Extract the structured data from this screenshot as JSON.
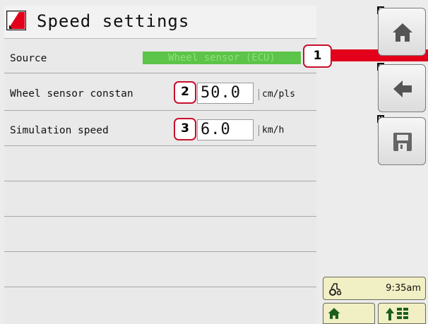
{
  "header": {
    "title": "Speed settings",
    "logo_icon": "red-slash-logo"
  },
  "rows": [
    {
      "label": "Source",
      "value": "Wheel sensor (ECU)"
    },
    {
      "label": "Wheel sensor constan",
      "value": "50.0",
      "unit": "cm/pls"
    },
    {
      "label": "Simulation speed",
      "value": "6.0",
      "unit": "km/h"
    }
  ],
  "callouts": [
    "1",
    "2",
    "3"
  ],
  "softkeys": [
    {
      "key": "F",
      "icon": "home-icon"
    },
    {
      "key": "G",
      "icon": "back-arrow-icon"
    },
    {
      "key": "H",
      "icon": "save-icon"
    }
  ],
  "status": {
    "time": "9:35am",
    "icon": "tractor-icon"
  },
  "bottom_buttons": [
    {
      "icon": "home-icon"
    },
    {
      "icon": "arrow-grid-icon"
    }
  ],
  "colors": {
    "accent": "#e2001a",
    "source_bg": "#5cc448",
    "status_bg": "#f1efc4"
  }
}
